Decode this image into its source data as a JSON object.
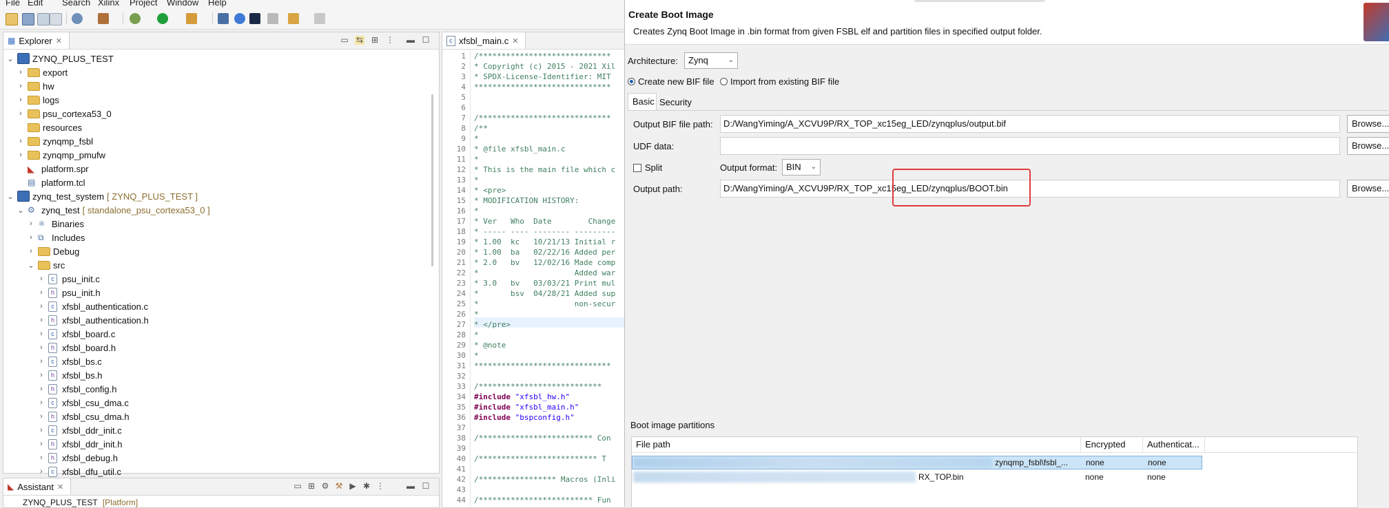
{
  "menu": [
    "File",
    "Edit",
    "Search",
    "Xilinx",
    "Project",
    "Window",
    "Help"
  ],
  "explorer": {
    "tab_label": "Explorer",
    "tree": [
      {
        "label": "ZYNQ_PLUS_TEST",
        "depth": 0,
        "open": true,
        "icon": "project-icon"
      },
      {
        "label": "export",
        "depth": 1,
        "open": false,
        "icon": "folder-icon"
      },
      {
        "label": "hw",
        "depth": 1,
        "open": false,
        "icon": "folder-icon"
      },
      {
        "label": "logs",
        "depth": 1,
        "open": false,
        "icon": "folder-icon"
      },
      {
        "label": "psu_cortexa53_0",
        "depth": 1,
        "open": false,
        "icon": "folder-icon"
      },
      {
        "label": "resources",
        "depth": 1,
        "open": null,
        "icon": "folder-icon"
      },
      {
        "label": "zynqmp_fsbl",
        "depth": 1,
        "open": false,
        "icon": "folder-icon"
      },
      {
        "label": "zynqmp_pmufw",
        "depth": 1,
        "open": false,
        "icon": "folder-icon"
      },
      {
        "label": "platform.spr",
        "depth": 1,
        "open": null,
        "icon": "xilinx-spr-icon"
      },
      {
        "label": "platform.tcl",
        "depth": 1,
        "open": null,
        "icon": "file-icon"
      },
      {
        "label": "zynq_test_system",
        "depth": 0,
        "open": true,
        "icon": "system-icon",
        "deco": "[ ZYNQ_PLUS_TEST ]"
      },
      {
        "label": "zynq_test",
        "depth": 1,
        "open": true,
        "icon": "app-icon",
        "deco": "[ standalone_psu_cortexa53_0 ]"
      },
      {
        "label": "Binaries",
        "depth": 2,
        "open": false,
        "icon": "binaries-icon"
      },
      {
        "label": "Includes",
        "depth": 2,
        "open": false,
        "icon": "includes-icon"
      },
      {
        "label": "Debug",
        "depth": 2,
        "open": false,
        "icon": "folder-icon"
      },
      {
        "label": "src",
        "depth": 2,
        "open": true,
        "icon": "folder-icon"
      },
      {
        "label": "psu_init.c",
        "depth": 3,
        "open": false,
        "icon": "c-file-icon"
      },
      {
        "label": "psu_init.h",
        "depth": 3,
        "open": false,
        "icon": "h-file-icon"
      },
      {
        "label": "xfsbl_authentication.c",
        "depth": 3,
        "open": false,
        "icon": "c-file-icon"
      },
      {
        "label": "xfsbl_authentication.h",
        "depth": 3,
        "open": false,
        "icon": "h-file-icon"
      },
      {
        "label": "xfsbl_board.c",
        "depth": 3,
        "open": false,
        "icon": "c-file-icon"
      },
      {
        "label": "xfsbl_board.h",
        "depth": 3,
        "open": false,
        "icon": "h-file-icon"
      },
      {
        "label": "xfsbl_bs.c",
        "depth": 3,
        "open": false,
        "icon": "c-file-icon"
      },
      {
        "label": "xfsbl_bs.h",
        "depth": 3,
        "open": false,
        "icon": "h-file-icon"
      },
      {
        "label": "xfsbl_config.h",
        "depth": 3,
        "open": false,
        "icon": "h-file-icon"
      },
      {
        "label": "xfsbl_csu_dma.c",
        "depth": 3,
        "open": false,
        "icon": "c-file-icon"
      },
      {
        "label": "xfsbl_csu_dma.h",
        "depth": 3,
        "open": false,
        "icon": "h-file-icon"
      },
      {
        "label": "xfsbl_ddr_init.c",
        "depth": 3,
        "open": false,
        "icon": "c-file-icon"
      },
      {
        "label": "xfsbl_ddr_init.h",
        "depth": 3,
        "open": false,
        "icon": "h-file-icon"
      },
      {
        "label": "xfsbl_debug.h",
        "depth": 3,
        "open": false,
        "icon": "h-file-icon"
      },
      {
        "label": "xfsbl_dfu_util.c",
        "depth": 3,
        "open": false,
        "icon": "c-file-icon"
      }
    ]
  },
  "assistant": {
    "tab_label": "Assistant",
    "row_label": "ZYNQ_PLUS_TEST",
    "row_deco": "[Platform]"
  },
  "editor": {
    "tab_label": "xfsbl_main.c",
    "lines": [
      {
        "n": "1",
        "t": "/*****************************",
        "c": "cmt"
      },
      {
        "n": "2",
        "t": "* Copyright (c) 2015 - 2021 Xil",
        "c": "cmt"
      },
      {
        "n": "3",
        "t": "* SPDX-License-Identifier: MIT",
        "c": "cmt"
      },
      {
        "n": "4",
        "t": "******************************",
        "c": "cmt"
      },
      {
        "n": "5",
        "t": "",
        "c": "cmt"
      },
      {
        "n": "6",
        "t": "",
        "c": "cmt"
      },
      {
        "n": "7",
        "t": "/*****************************",
        "c": "cmt"
      },
      {
        "n": "8",
        "t": "/**",
        "c": "cmt"
      },
      {
        "n": "9",
        "t": "*",
        "c": "cmt"
      },
      {
        "n": "10",
        "t": "* @file xfsbl_main.c",
        "c": "cmt"
      },
      {
        "n": "11",
        "t": "*",
        "c": "cmt"
      },
      {
        "n": "12",
        "t": "* This is the main file which c",
        "c": "cmt"
      },
      {
        "n": "13",
        "t": "*",
        "c": "cmt"
      },
      {
        "n": "14",
        "t": "* <pre>",
        "c": "cmt"
      },
      {
        "n": "15",
        "t": "* MODIFICATION HISTORY:",
        "c": "cmt"
      },
      {
        "n": "16",
        "t": "*",
        "c": "cmt"
      },
      {
        "n": "17",
        "t": "* Ver   Who  Date        Change",
        "c": "cmt"
      },
      {
        "n": "18",
        "t": "* ----- ---- -------- ---------",
        "c": "cmt"
      },
      {
        "n": "19",
        "t": "* 1.00  kc   10/21/13 Initial r",
        "c": "cmt"
      },
      {
        "n": "20",
        "t": "* 1.00  ba   02/22/16 Added per",
        "c": "cmt"
      },
      {
        "n": "21",
        "t": "* 2.0   bv   12/02/16 Made comp",
        "c": "cmt"
      },
      {
        "n": "22",
        "t": "*                     Added war",
        "c": "cmt"
      },
      {
        "n": "23",
        "t": "* 3.0   bv   03/03/21 Print mul",
        "c": "cmt"
      },
      {
        "n": "24",
        "t": "*       bsv  04/28/21 Added sup",
        "c": "cmt"
      },
      {
        "n": "25",
        "t": "*                     non-secur",
        "c": "cmt"
      },
      {
        "n": "26",
        "t": "*",
        "c": "cmt"
      },
      {
        "n": "27",
        "t": "* </pre>",
        "c": "cmt"
      },
      {
        "n": "28",
        "t": "*",
        "c": "cmt"
      },
      {
        "n": "29",
        "t": "* @note",
        "c": "cmt"
      },
      {
        "n": "30",
        "t": "*",
        "c": "cmt"
      },
      {
        "n": "31",
        "t": "******************************",
        "c": "cmt"
      },
      {
        "n": "32",
        "t": "",
        "c": "cmt"
      },
      {
        "n": "33",
        "t": "/***************************",
        "c": "cmt"
      },
      {
        "n": "34",
        "t": "#include \"xfsbl_hw.h\"",
        "c": "inc"
      },
      {
        "n": "35",
        "t": "#include \"xfsbl_main.h\"",
        "c": "inc"
      },
      {
        "n": "36",
        "t": "#include \"bspconfig.h\"",
        "c": "inc"
      },
      {
        "n": "37",
        "t": "",
        "c": "cmt"
      },
      {
        "n": "38",
        "t": "/************************* Con",
        "c": "cmt"
      },
      {
        "n": "39",
        "t": "",
        "c": "cmt"
      },
      {
        "n": "40",
        "t": "/************************** T",
        "c": "cmt"
      },
      {
        "n": "41",
        "t": "",
        "c": "cmt"
      },
      {
        "n": "42",
        "t": "/***************** Macros (Inli",
        "c": "cmt"
      },
      {
        "n": "43",
        "t": "",
        "c": "cmt"
      },
      {
        "n": "44",
        "t": "/************************* Fun",
        "c": "cmt"
      }
    ]
  },
  "dialog": {
    "title": "Create Boot Image",
    "description": "Creates Zynq Boot Image in .bin format from given FSBL elf and partition files in specified output folder.",
    "architecture_label": "Architecture:",
    "architecture_value": "Zynq",
    "radio_create": "Create new BIF file",
    "radio_import": "Import from existing BIF file",
    "tabs": [
      "Basic",
      "Security"
    ],
    "output_bif_label": "Output BIF file path:",
    "output_bif_value": "D:/WangYiming/A_XCVU9P/RX_TOP_xc15eg_LED/zynqplus/output.bif",
    "udf_label": "UDF data:",
    "udf_value": "",
    "split_label": "Split",
    "output_format_label": "Output format:",
    "output_format_value": "BIN",
    "output_path_label": "Output path:",
    "output_path_value": "D:/WangYiming/A_XCVU9P/RX_TOP_xc15eg_LED/zynqplus/BOOT.bin",
    "browse_label": "Browse...",
    "partitions_label": "Boot image partitions",
    "table_headers": [
      "File path",
      "Encrypted",
      "Authenticat..."
    ],
    "rows": [
      {
        "path_visible": "zynqmp_fsbl\\fsbl_...",
        "encrypted": "none",
        "auth": "none"
      },
      {
        "path_visible": "RX_TOP.bin",
        "encrypted": "none",
        "auth": "none"
      }
    ]
  },
  "colors": {
    "highlight_box": "#e03a3a",
    "selected_row": "#cce4f7",
    "comment": "#3f7f5f",
    "keyword": "#7f0055",
    "string": "#2a00ff"
  }
}
